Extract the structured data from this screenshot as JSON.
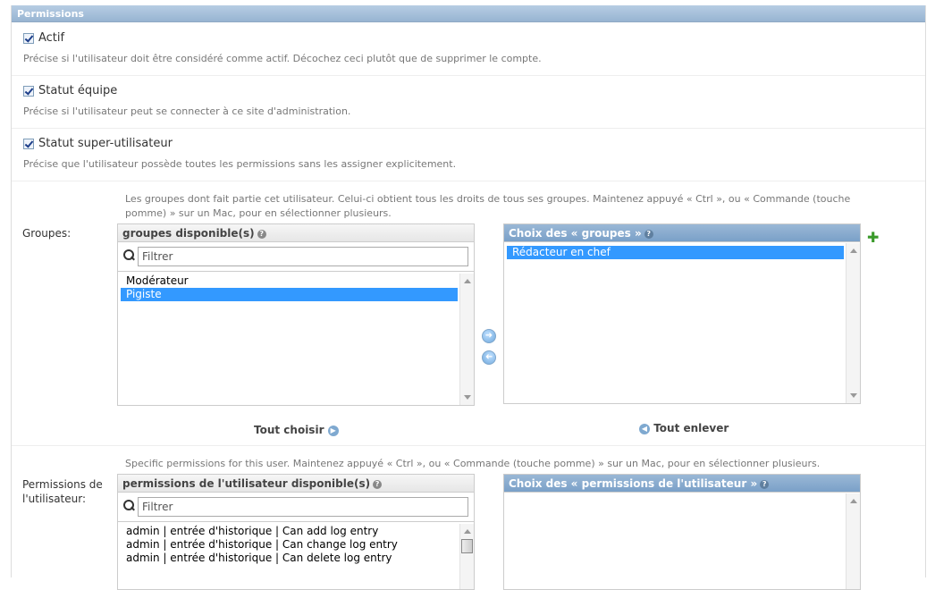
{
  "module": {
    "title": "Permissions"
  },
  "fields": {
    "actif": {
      "label": "Actif",
      "help": "Précise si l'utilisateur doit être considéré comme actif. Décochez ceci plutôt que de supprimer le compte."
    },
    "staff": {
      "label": "Statut équipe",
      "help": "Précise si l'utilisateur peut se connecter à ce site d'administration."
    },
    "superuser": {
      "label": "Statut super-utilisateur",
      "help": "Précise que l'utilisateur possède toutes les permissions sans les assigner explicitement."
    }
  },
  "groups": {
    "label": "Groupes:",
    "help": "Les groupes dont fait partie cet utilisateur. Celui-ci obtient tous les droits de tous ses groupes. Maintenez appuyé « Ctrl », ou « Commande (touche pomme) » sur un Mac, pour en sélectionner plusieurs.",
    "available_title": "groupes disponible(s)",
    "chosen_title": "Choix des « groupes »",
    "filter_placeholder": "Filtrer",
    "available": [
      "Modérateur",
      "Pigiste"
    ],
    "selected_available": "Pigiste",
    "chosen": [
      "Rédacteur en chef"
    ],
    "choose_all": "Tout choisir",
    "remove_all": "Tout enlever"
  },
  "permissions": {
    "label": "Permissions de l'utilisateur:",
    "help": "Specific permissions for this user. Maintenez appuyé « Ctrl », ou « Commande (touche pomme) » sur un Mac, pour en sélectionner plusieurs.",
    "available_title": "permissions de l'utilisateur disponible(s)",
    "chosen_title": "Choix des « permissions de l'utilisateur »",
    "filter_placeholder": "Filtrer",
    "available": [
      "admin | entrée d'historique | Can add log entry",
      "admin | entrée d'historique | Can change log entry",
      "admin | entrée d'historique | Can delete log entry"
    ]
  },
  "icons": {
    "help": "question-icon",
    "add": "plus-icon",
    "search": "search-icon"
  }
}
